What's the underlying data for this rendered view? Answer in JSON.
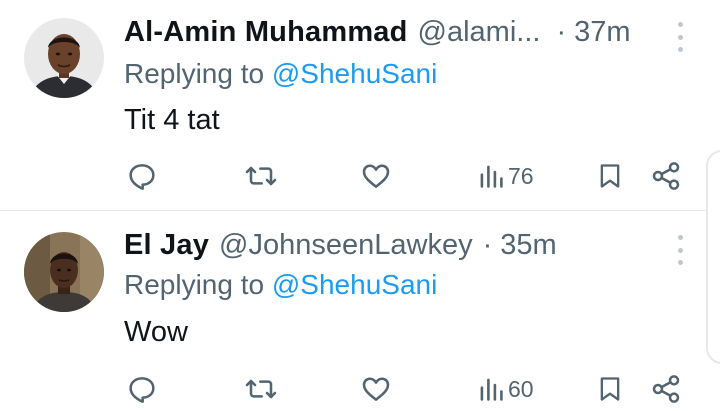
{
  "tweets": [
    {
      "name": "Al-Amin Muhammad",
      "handle": "@alami...",
      "dot": "·",
      "time": "37m",
      "replying_prefix": "Replying to ",
      "replying_to": "@ShehuSani",
      "text": "Tit 4 tat",
      "views": "76"
    },
    {
      "name": "El Jay",
      "handle": "@JohnseenLawkey",
      "dot": "·",
      "time": "35m",
      "replying_prefix": "Replying to ",
      "replying_to": "@ShehuSani",
      "text": "Wow",
      "views": "60"
    }
  ],
  "colors": {
    "accent": "#1d9bf0",
    "secondary_text": "#536471",
    "primary_text": "#0f1419",
    "divider": "#e6e9ec"
  },
  "icons": [
    "reply-icon",
    "retweet-icon",
    "like-icon",
    "views-icon",
    "bookmark-icon",
    "share-icon",
    "more-icon"
  ]
}
